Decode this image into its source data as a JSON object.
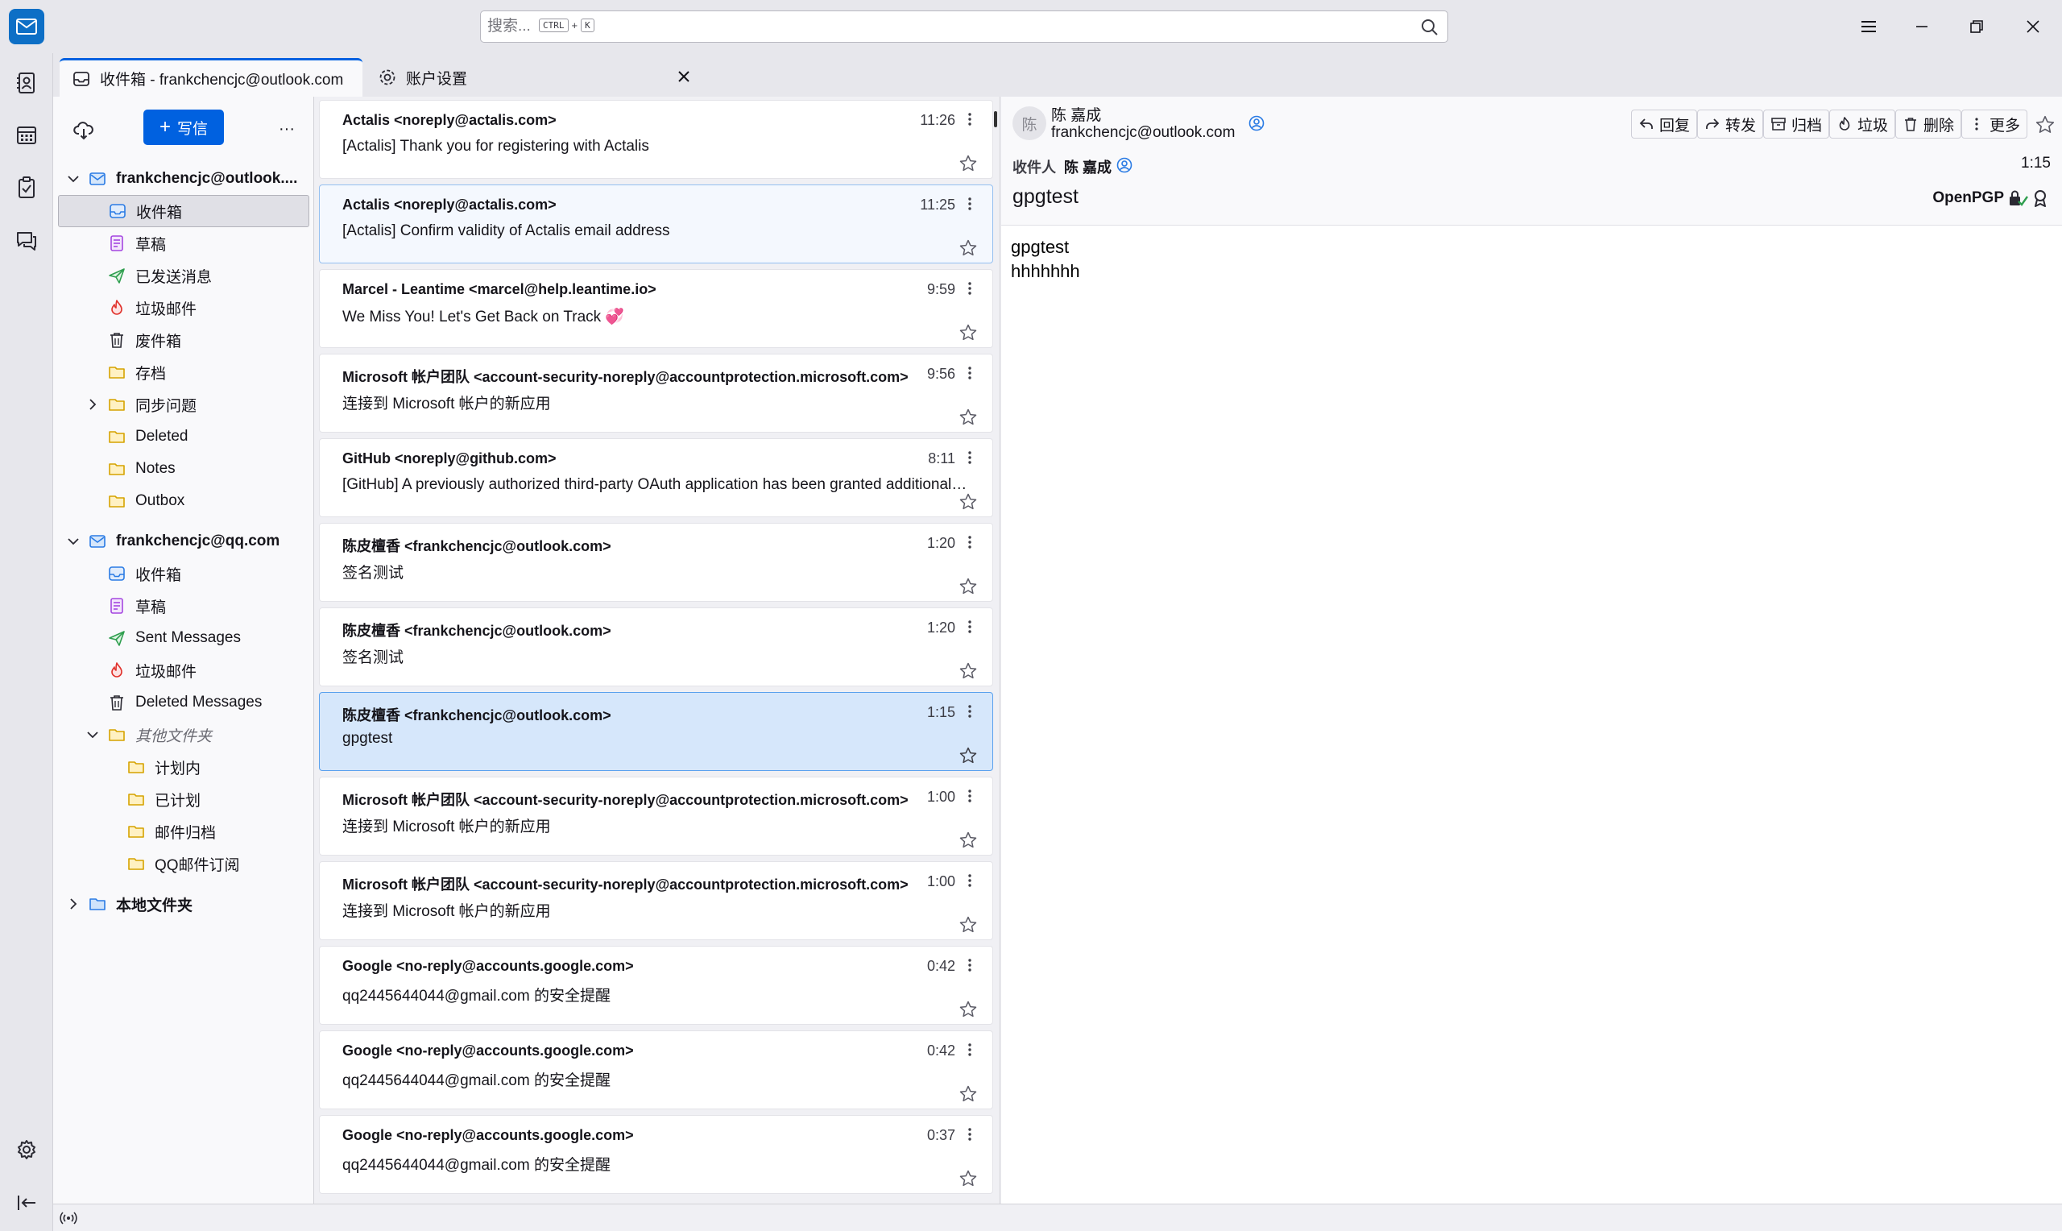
{
  "search": {
    "placeholder": "搜索...",
    "key_ctrl": "CTRL",
    "key_plus": "+",
    "key_k": "K"
  },
  "tabs": [
    {
      "label": "收件箱 - frankchencjc@outlook.com"
    },
    {
      "label": "账户设置"
    }
  ],
  "folder_pane": {
    "write_label": "写信",
    "write_plus": "+",
    "more": "···"
  },
  "accounts": [
    {
      "name": "frankchencjc@outlook....",
      "folders": [
        "收件箱",
        "草稿",
        "已发送消息",
        "垃圾邮件",
        "废件箱",
        "存档",
        "同步问题",
        "Deleted",
        "Notes",
        "Outbox"
      ]
    },
    {
      "name": "frankchencjc@qq.com",
      "folders": [
        "收件箱",
        "草稿",
        "Sent Messages",
        "垃圾邮件",
        "Deleted Messages",
        "其他文件夹",
        "计划内",
        "已计划",
        "邮件归档",
        "QQ邮件订阅"
      ]
    },
    {
      "name": "本地文件夹"
    }
  ],
  "messages": [
    {
      "sender": "Actalis <noreply@actalis.com>",
      "subject": "[Actalis] Thank you for registering with Actalis",
      "time": "11:26"
    },
    {
      "sender": "Actalis <noreply@actalis.com>",
      "subject": "[Actalis] Confirm validity of Actalis email address",
      "time": "11:25"
    },
    {
      "sender": "Marcel - Leantime <marcel@help.leantime.io>",
      "subject": "We Miss You! Let's Get Back on Track 💞",
      "time": "9:59"
    },
    {
      "sender": "Microsoft 帐户团队 <account-security-noreply@accountprotection.microsoft.com>",
      "subject": "连接到 Microsoft 帐户的新应用",
      "time": "9:56"
    },
    {
      "sender": "GitHub <noreply@github.com>",
      "subject": "[GitHub] A previously authorized third-party OAuth application has been granted additional scopes",
      "time": "8:11"
    },
    {
      "sender": "陈皮檀香 <frankchencjc@outlook.com>",
      "subject": "签名测试",
      "time": "1:20"
    },
    {
      "sender": "陈皮檀香 <frankchencjc@outlook.com>",
      "subject": "签名测试",
      "time": "1:20"
    },
    {
      "sender": "陈皮檀香 <frankchencjc@outlook.com>",
      "subject": "gpgtest",
      "time": "1:15"
    },
    {
      "sender": "Microsoft 帐户团队 <account-security-noreply@accountprotection.microsoft.com>",
      "subject": "连接到 Microsoft 帐户的新应用",
      "time": "1:00"
    },
    {
      "sender": "Microsoft 帐户团队 <account-security-noreply@accountprotection.microsoft.com>",
      "subject": "连接到 Microsoft 帐户的新应用",
      "time": "1:00"
    },
    {
      "sender": "Google <no-reply@accounts.google.com>",
      "subject": "qq2445644044@gmail.com 的安全提醒",
      "time": "0:42"
    },
    {
      "sender": "Google <no-reply@accounts.google.com>",
      "subject": "qq2445644044@gmail.com 的安全提醒",
      "time": "0:42"
    },
    {
      "sender": "Google <no-reply@accounts.google.com>",
      "subject": "qq2445644044@gmail.com 的安全提醒",
      "time": "0:37"
    }
  ],
  "reader": {
    "avatar": "陈",
    "from_name": "陈 嘉成",
    "from_addr": "frankchencjc@outlook.com",
    "actions": {
      "reply": "回复",
      "forward": "转发",
      "archive": "归档",
      "junk": "垃圾",
      "delete": "删除",
      "more": "更多"
    },
    "to_label": "收件人",
    "to_value": "陈 嘉成",
    "date": "1:15",
    "subject": "gpgtest",
    "openpgp": "OpenPGP",
    "body_lines": [
      "gpgtest",
      "hhhhhhh"
    ]
  },
  "colors": {
    "accent": "#0061e0",
    "app_logo": "#0d6fc6",
    "selected_card": "#d6e7fb"
  }
}
